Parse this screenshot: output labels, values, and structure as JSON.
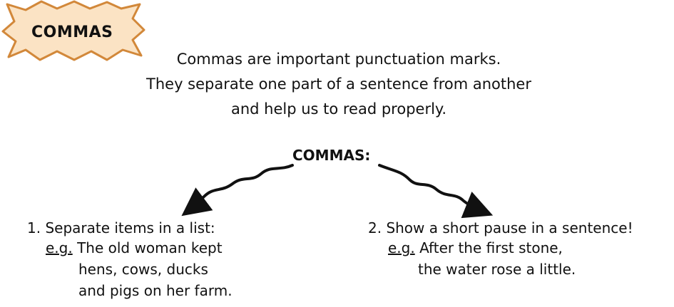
{
  "badge": {
    "title": "COMMAS"
  },
  "intro": {
    "lines": [
      "Commas are important punctuation marks.",
      "They separate one part of a sentence from another",
      "and help us to read properly."
    ]
  },
  "diagram": {
    "heading": "COMMAS:",
    "left": {
      "title": "1. Separate items in a list:",
      "eg_label": "e.g.",
      "example_lines": [
        "The old woman kept",
        "hens, cows, ducks",
        "and pigs on her farm."
      ]
    },
    "right": {
      "title": "2. Show a short pause in a sentence!",
      "eg_label": "e.g.",
      "example_lines": [
        "After the first stone,",
        "the water rose a little."
      ]
    }
  },
  "colors": {
    "badge_fill": "#fbe3c4",
    "badge_stroke": "#d2883a",
    "ink": "#111111"
  }
}
